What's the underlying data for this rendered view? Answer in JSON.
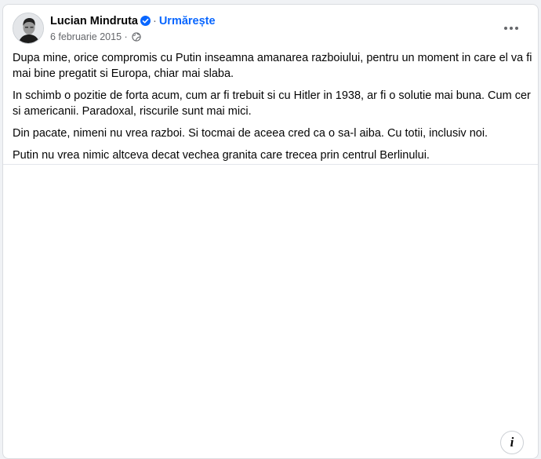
{
  "post": {
    "author": "Lucian Mindruta",
    "follow_label": "Urmărește",
    "separator": "·",
    "date": "6 februarie 2015",
    "meta_separator": "·",
    "paragraphs": [
      "Dupa mine, orice compromis cu Putin inseamna amanarea razboiului, pentru un moment in care el va fi mai bine pregatit si Europa, chiar mai slaba.",
      "In schimb o pozitie de forta acum, cum ar fi trebuit si cu Hitler in 1938, ar fi o solutie mai buna. Cum cer si americanii. Paradoxal, riscurile sunt mai mici.",
      "Din pacate, nimeni nu vrea razboi. Si tocmai de aceea cred ca o sa-l aiba. Cu totii, inclusiv noi.",
      "Putin nu vrea nimic altceva decat vechea granita care trecea prin centrul Berlinului."
    ]
  },
  "icons": {
    "verified": "verified-badge-icon",
    "audience": "globe-icon",
    "more": "more-options-icon",
    "info": "info-icon"
  },
  "info_glyph": "i",
  "colors": {
    "accent": "#0866ff",
    "text": "#050505",
    "secondary": "#65676b",
    "page_bg": "#f0f2f5"
  }
}
